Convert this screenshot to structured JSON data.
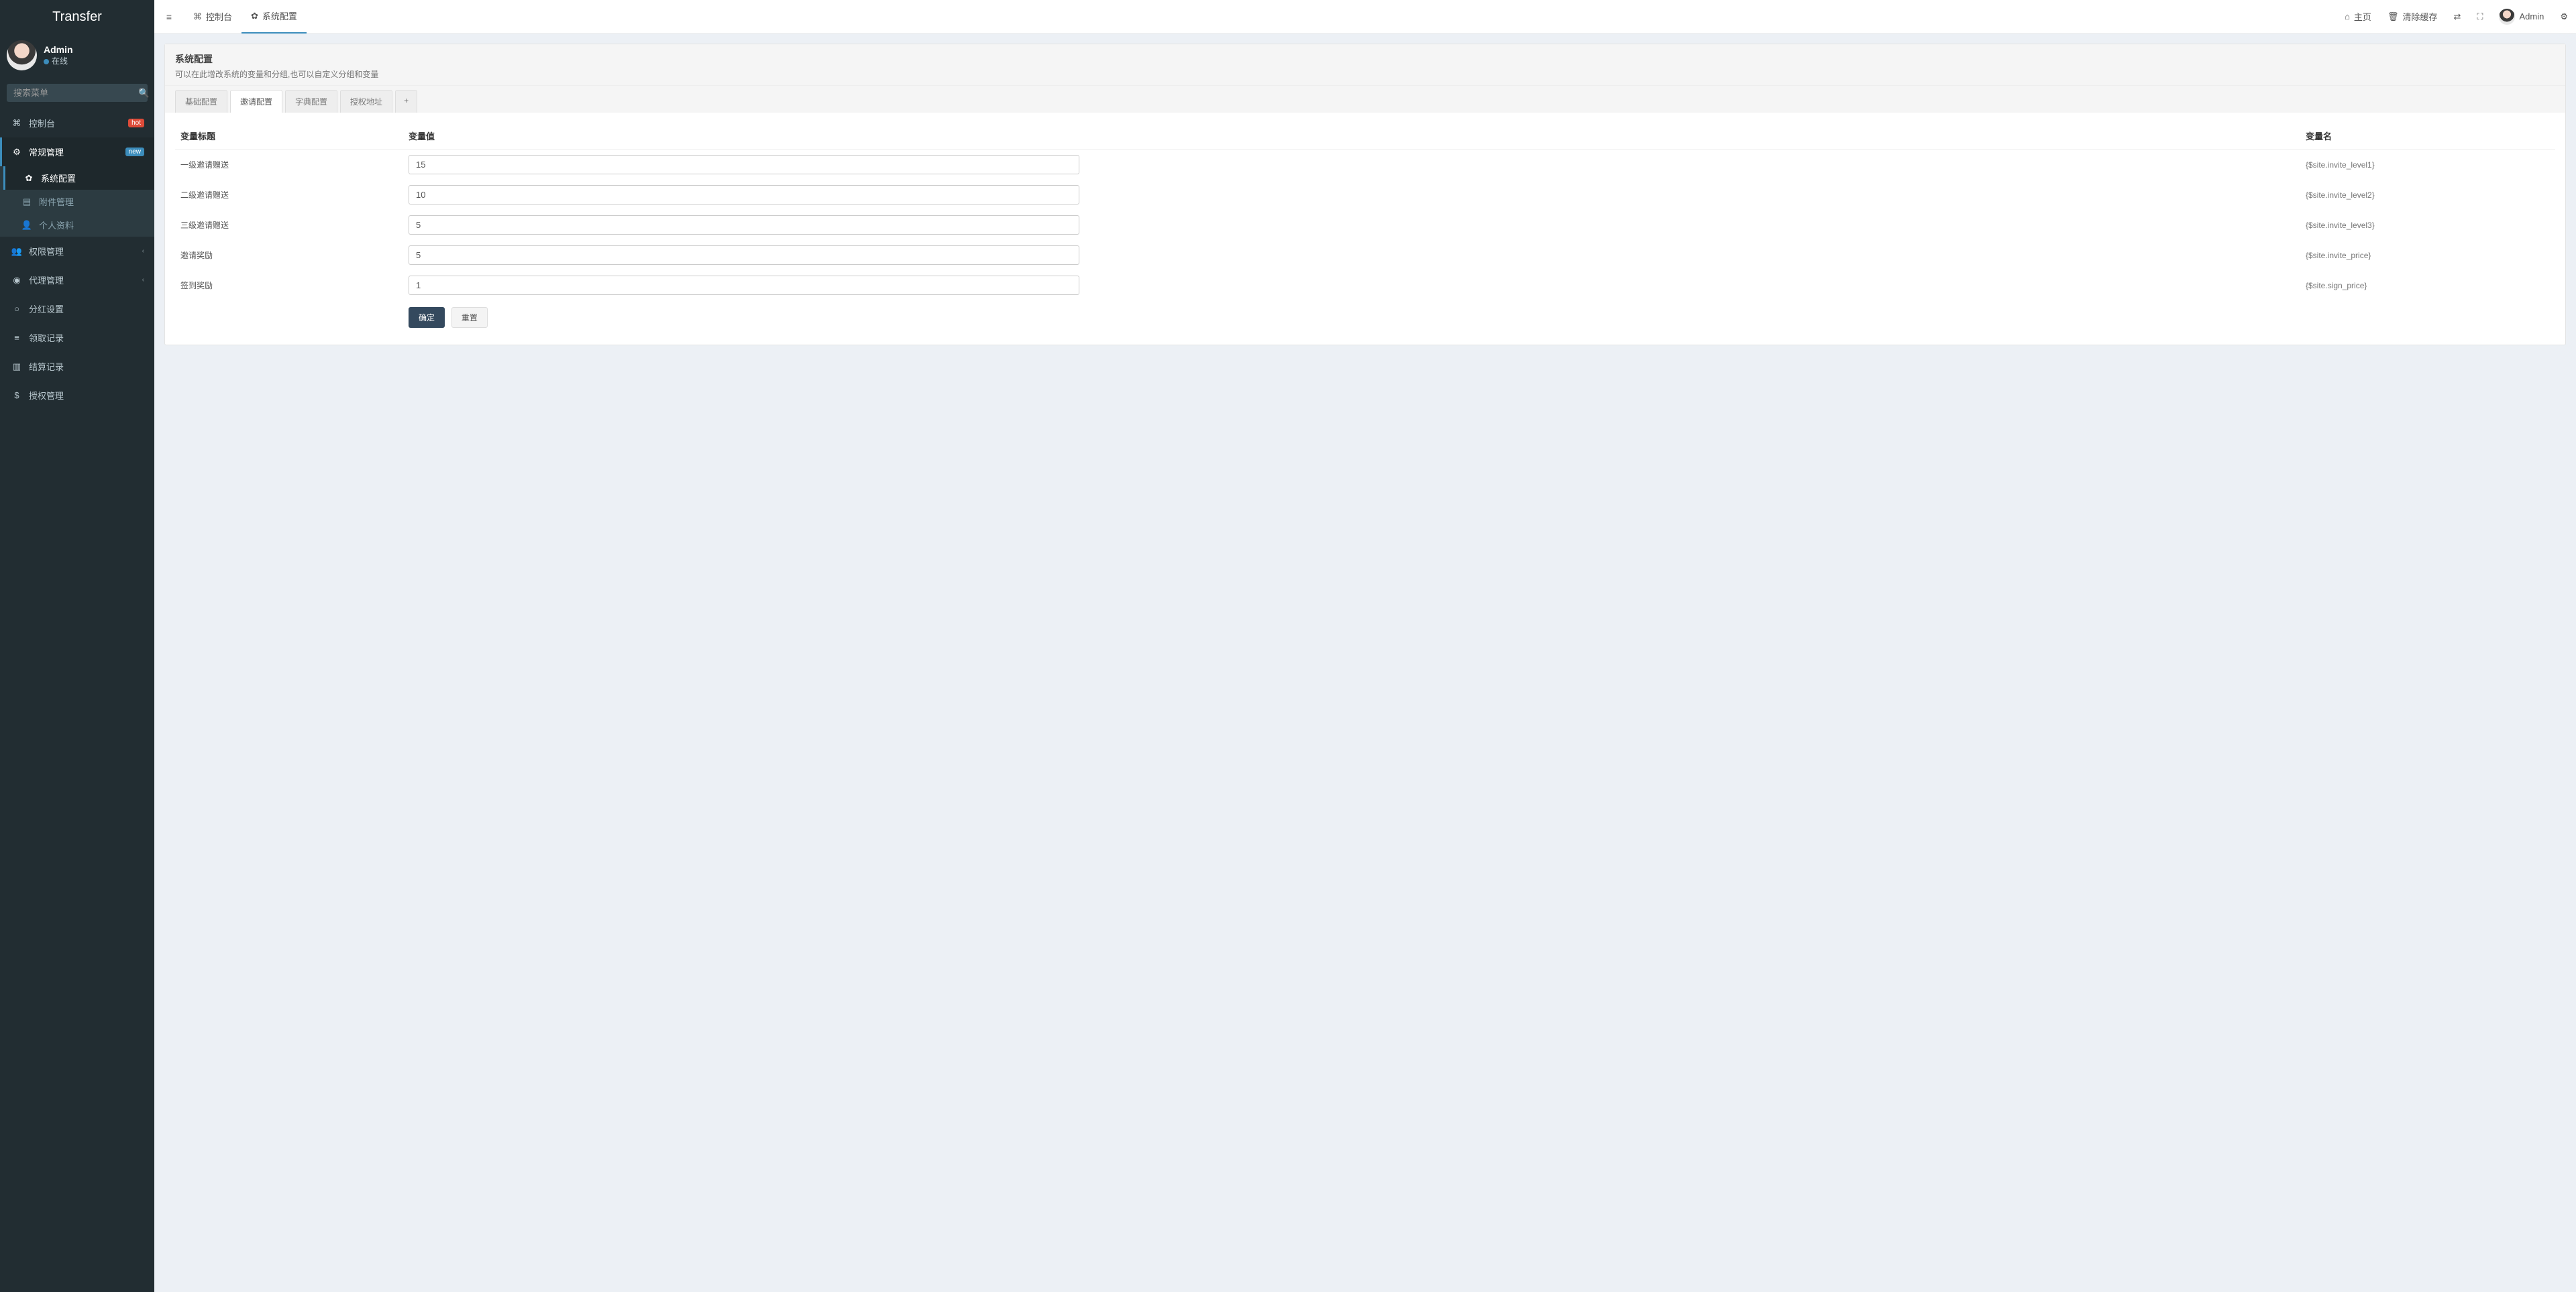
{
  "brand": "Transfer",
  "user": {
    "name": "Admin",
    "status": "在线"
  },
  "search": {
    "placeholder": "搜索菜单"
  },
  "sidebar": {
    "items": [
      {
        "label": "控制台",
        "icon": "dashboard",
        "badge": "hot",
        "badge_class": "badge-hot"
      },
      {
        "label": "常规管理",
        "icon": "cogs",
        "badge": "new",
        "badge_class": "badge-new",
        "children": [
          {
            "label": "系统配置",
            "icon": "cog",
            "active": true
          },
          {
            "label": "附件管理",
            "icon": "file"
          },
          {
            "label": "个人资料",
            "icon": "user"
          }
        ]
      },
      {
        "label": "权限管理",
        "icon": "group",
        "caret": true
      },
      {
        "label": "代理管理",
        "icon": "user-circle",
        "caret": true
      },
      {
        "label": "分红设置",
        "icon": "circle-o"
      },
      {
        "label": "领取记录",
        "icon": "bars"
      },
      {
        "label": "结算记录",
        "icon": "list-alt"
      },
      {
        "label": "授权管理",
        "icon": "usd"
      }
    ]
  },
  "top_tabs": [
    {
      "label": "控制台",
      "icon": "dashboard"
    },
    {
      "label": "系统配置",
      "icon": "cog",
      "active": true
    }
  ],
  "topbar": {
    "home": "主页",
    "clear_cache": "清除缓存",
    "admin": "Admin"
  },
  "panel": {
    "title": "系统配置",
    "desc": "可以在此增改系统的变量和分组,也可以自定义分组和变量",
    "tabs": [
      "基础配置",
      "邀请配置",
      "字典配置",
      "授权地址"
    ],
    "active_tab": 1,
    "columns": {
      "label": "变量标题",
      "value": "变量值",
      "var": "变量名"
    },
    "rows": [
      {
        "label": "一级邀请赠送",
        "value": "15",
        "varname": "{$site.invite_level1}"
      },
      {
        "label": "二级邀请赠送",
        "value": "10",
        "varname": "{$site.invite_level2}"
      },
      {
        "label": "三级邀请赠送",
        "value": "5",
        "varname": "{$site.invite_level3}"
      },
      {
        "label": "邀请奖励",
        "value": "5",
        "varname": "{$site.invite_price}"
      },
      {
        "label": "签到奖励",
        "value": "1",
        "varname": "{$site.sign_price}"
      }
    ],
    "actions": {
      "ok": "确定",
      "reset": "重置"
    }
  },
  "icons": {
    "dashboard": "⌘",
    "cogs": "⚙",
    "cog": "✿",
    "file": "▤",
    "user": "👤",
    "group": "👥",
    "user-circle": "◉",
    "circle-o": "○",
    "bars": "≡",
    "list-alt": "▥",
    "usd": "$",
    "home": "⌂",
    "trash": "🗑",
    "language": "⇄",
    "expand": "⛶",
    "settings": "⚙",
    "plus": "+",
    "search": "🔍",
    "menu": "≡",
    "caret": "‹"
  }
}
